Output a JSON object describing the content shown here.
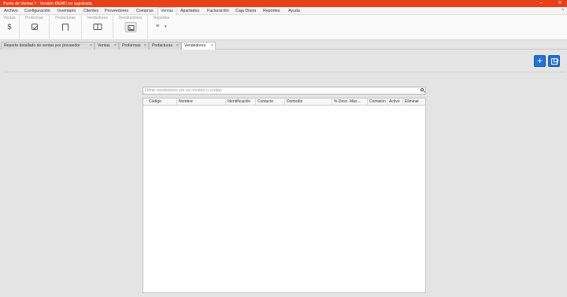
{
  "window": {
    "title": "Punto de Ventas 7 : Versión DEMO no registrada",
    "minimize": "–",
    "close": "✕"
  },
  "menubar": {
    "items": [
      "Archivo",
      "Configuración",
      "Inventario",
      "Clientes",
      "Proveedores",
      "Compras",
      "Ventas",
      "Apartados",
      "Facturación",
      "Caja Diaria",
      "Reportes",
      "Ayuda"
    ],
    "active": "Ventas",
    "collapse": "^"
  },
  "ribbon": {
    "groups": [
      {
        "label": "Ventas",
        "icon": "dollar-icon"
      },
      {
        "label": "Proformas",
        "icon": "checkbox-icon"
      },
      {
        "label": "Prefacturas",
        "icon": "document-icon"
      },
      {
        "label": "Vendedores",
        "icon": "book-icon"
      },
      {
        "label": "Devoluciones",
        "icon": "return-icon"
      },
      {
        "label": "Reportes",
        "icon": "report-list-icon"
      }
    ],
    "dollar_glyph": "$",
    "report_glyph": "≡",
    "caret": "▾"
  },
  "tabs": [
    {
      "label": "Reporte detallado de ventas por proveedor",
      "close": "×"
    },
    {
      "label": "Ventas",
      "close": "×"
    },
    {
      "label": "Proformas",
      "close": "×"
    },
    {
      "label": "Prefacturas",
      "close": "×"
    },
    {
      "label": "Vendedores",
      "close": "×"
    }
  ],
  "active_tab": "Vendedores",
  "actions": {
    "add": "+",
    "accent_color": "#1f74d6"
  },
  "search": {
    "placeholder": "Filtrar vendedores por su nombre o código",
    "value": ""
  },
  "grid": {
    "columns": [
      "Código",
      "Nombre",
      "Identificación",
      "Contacto",
      "Domicilio",
      "% Desc. Máx...",
      "Comisión",
      "Activo",
      "Eliminar"
    ],
    "rows": []
  },
  "colors": {
    "titlebar": "#e8401a",
    "background": "#e4e4e4"
  }
}
